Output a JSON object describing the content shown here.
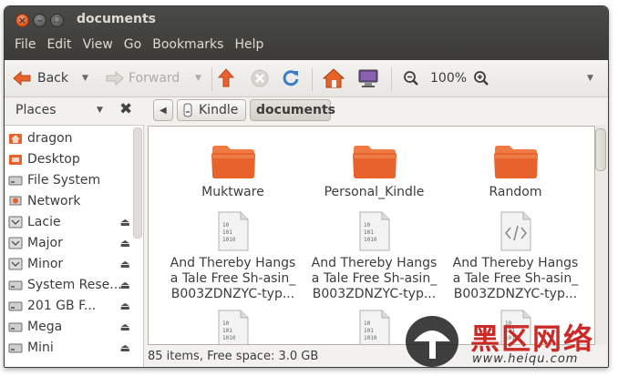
{
  "window": {
    "title": "documents"
  },
  "menu": [
    "File",
    "Edit",
    "View",
    "Go",
    "Bookmarks",
    "Help"
  ],
  "toolbar": {
    "back_label": "Back",
    "forward_label": "Forward",
    "zoom_level": "100%"
  },
  "pathbar": {
    "crumbs": [
      "Kindle",
      "documents"
    ]
  },
  "sidebar": {
    "header": "Places",
    "items": [
      {
        "label": "dragon",
        "icon": "home-folder-icon",
        "eject": false
      },
      {
        "label": "Desktop",
        "icon": "desktop-folder-icon",
        "eject": false
      },
      {
        "label": "File System",
        "icon": "harddisk-icon",
        "eject": false
      },
      {
        "label": "Network",
        "icon": "network-icon",
        "eject": false
      },
      {
        "label": "Lacie",
        "icon": "drive-icon",
        "eject": true
      },
      {
        "label": "Major",
        "icon": "drive-icon",
        "eject": true
      },
      {
        "label": "Minor",
        "icon": "drive-icon",
        "eject": true
      },
      {
        "label": "System Rese...",
        "icon": "harddisk-icon",
        "eject": true
      },
      {
        "label": "201 GB F...",
        "icon": "harddisk-icon",
        "eject": true
      },
      {
        "label": "Mega",
        "icon": "harddisk-icon",
        "eject": true
      },
      {
        "label": "Mini",
        "icon": "harddisk-icon",
        "eject": true
      }
    ]
  },
  "files": [
    {
      "type": "folder",
      "lines": [
        "Muktware"
      ]
    },
    {
      "type": "folder",
      "lines": [
        "Personal_Kindle"
      ]
    },
    {
      "type": "folder",
      "lines": [
        "Random"
      ]
    },
    {
      "type": "binary",
      "lines": [
        "And Thereby Hangs",
        "a Tale Free Sh-asin_",
        "B003ZDNZYC-typ..."
      ]
    },
    {
      "type": "binary",
      "lines": [
        "And Thereby Hangs",
        "a Tale Free Sh-asin_",
        "B003ZDNZYC-typ..."
      ]
    },
    {
      "type": "code",
      "lines": [
        "And Thereby Hangs",
        "a Tale Free Sh-asin_",
        "B003ZDNZYC-typ..."
      ]
    },
    {
      "type": "binary",
      "lines": []
    },
    {
      "type": "binary",
      "lines": []
    },
    {
      "type": "binary",
      "lines": []
    }
  ],
  "binary_icon_text": [
    "10",
    "101",
    "1010"
  ],
  "status": "85 items, Free space: 3.0 GB",
  "watermark": {
    "cn_text": "黑区网络",
    "url": "www.heiqu.com"
  },
  "colors": {
    "titlebar": "#3c3b37",
    "folder_orange": "#e8622c",
    "accent_close": "#e15a23",
    "watermark_red": "#cc2a27"
  }
}
